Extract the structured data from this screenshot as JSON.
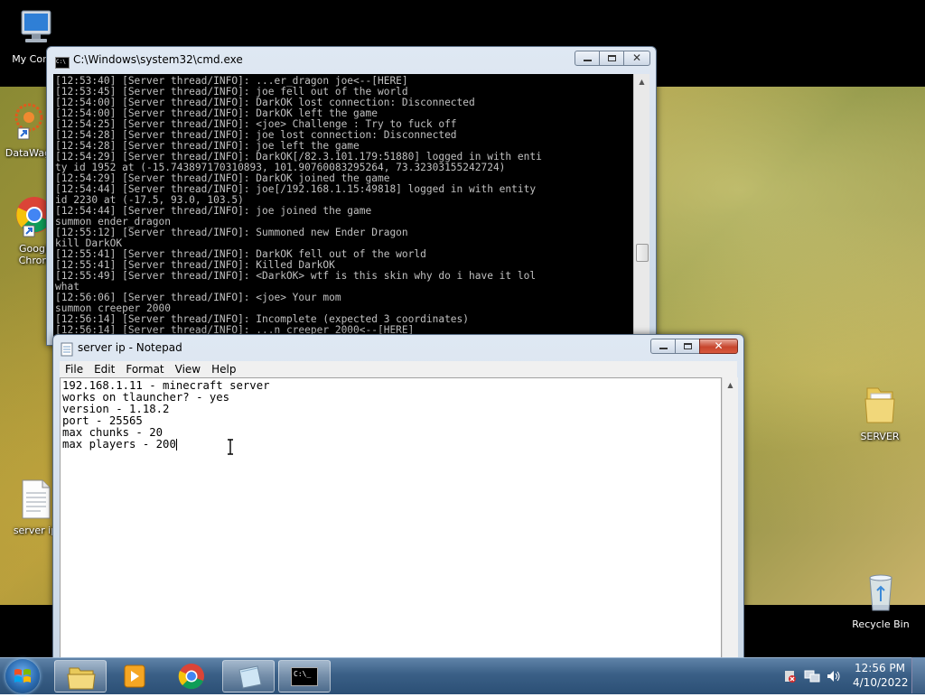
{
  "desktop": {
    "icons": [
      {
        "label": "My Comp",
        "icon": "computer-icon"
      },
      {
        "label": "DataWag",
        "icon": "datawag-icon"
      },
      {
        "label": "Googl",
        "label2": "Chron",
        "icon": "chrome-icon"
      },
      {
        "label": "server ip",
        "icon": "text-file-icon"
      },
      {
        "label": "SERVER",
        "icon": "folder-icon"
      },
      {
        "label": "Recycle Bin",
        "icon": "recycle-bin-icon"
      }
    ]
  },
  "cmd": {
    "title": "C:\\Windows\\system32\\cmd.exe",
    "lines": [
      "[12:53:40] [Server thread/INFO]: ...er_dragon joe<--[HERE]",
      "[12:53:45] [Server thread/INFO]: joe fell out of the world",
      "[12:54:00] [Server thread/INFO]: DarkOK lost connection: Disconnected",
      "[12:54:00] [Server thread/INFO]: DarkOK left the game",
      "[12:54:25] [Server thread/INFO]: <joe> Challenge : Try to fuck off",
      "[12:54:28] [Server thread/INFO]: joe lost connection: Disconnected",
      "[12:54:28] [Server thread/INFO]: joe left the game",
      "[12:54:29] [Server thread/INFO]: DarkOK[/82.3.101.179:51880] logged in with enti",
      "ty id 1952 at (-15.743897170310893, 101.90760083295264, 73.32303155242724)",
      "[12:54:29] [Server thread/INFO]: DarkOK joined the game",
      "[12:54:44] [Server thread/INFO]: joe[/192.168.1.15:49818] logged in with entity",
      "id 2230 at (-17.5, 93.0, 103.5)",
      "[12:54:44] [Server thread/INFO]: joe joined the game",
      "summon ender_dragon",
      "[12:55:12] [Server thread/INFO]: Summoned new Ender Dragon",
      "kill DarkOK",
      "[12:55:41] [Server thread/INFO]: DarkOK fell out of the world",
      "[12:55:41] [Server thread/INFO]: Killed DarkOK",
      "[12:55:49] [Server thread/INFO]: <DarkOK> wtf is this skin why do i have it lol",
      "what",
      "[12:56:06] [Server thread/INFO]: <joe> Your mom",
      "summon creeper 2000",
      "[12:56:14] [Server thread/INFO]: Incomplete (expected 3 coordinates)",
      "[12:56:14] [Server thread/INFO]: ...n creeper 2000<--[HERE]"
    ]
  },
  "notepad": {
    "title": "server ip - Notepad",
    "menu": [
      "File",
      "Edit",
      "Format",
      "View",
      "Help"
    ],
    "lines": [
      "192.168.1.11 - minecraft server",
      "works on tlauncher? - yes",
      "version - 1.18.2",
      "port - 25565",
      "max chunks - 20",
      "max players - 200"
    ]
  },
  "taskbar": {
    "buttons": [
      {
        "name": "explorer",
        "icon": "folder-icon"
      },
      {
        "name": "media-player",
        "icon": "media-player-icon"
      },
      {
        "name": "chrome",
        "icon": "chrome-icon"
      },
      {
        "name": "notepad",
        "icon": "notepad-icon"
      },
      {
        "name": "cmd",
        "icon": "cmd-icon",
        "label": "C:\\_"
      }
    ],
    "clock_time": "12:56 PM",
    "clock_date": "4/10/2022"
  },
  "colors": {
    "taskbar": "#3a5f86",
    "cmd_bg": "#000000",
    "cmd_fg": "#c0c0c0"
  }
}
